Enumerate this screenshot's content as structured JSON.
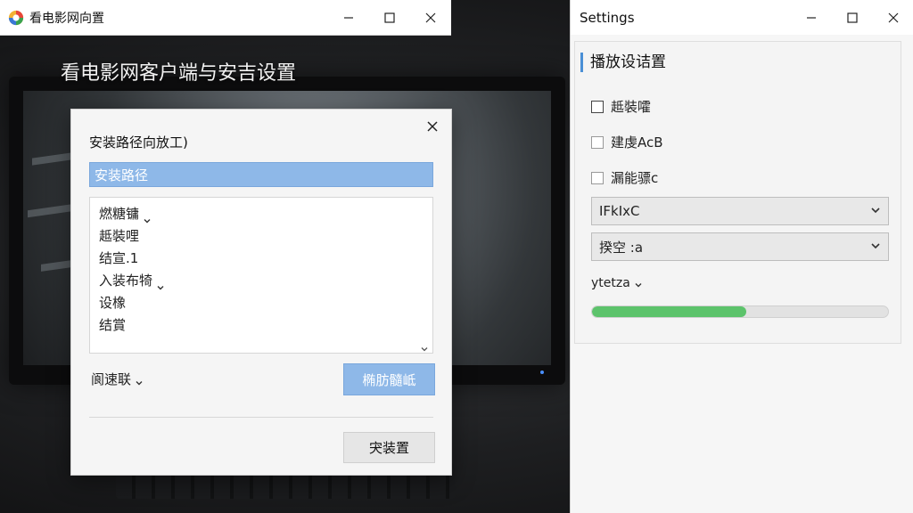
{
  "background": {
    "headline": "看电影网客户端与安吉设置"
  },
  "app_window": {
    "title": "看电影网向置"
  },
  "install_dialog": {
    "heading": "安装路径向放工)",
    "path_value": "安装路径",
    "list_items": [
      {
        "label": "燃糖镛",
        "has_chevron": true
      },
      {
        "label": "趆裝哩",
        "has_chevron": false
      },
      {
        "label": "结宣.1",
        "has_chevron": false
      },
      {
        "label": "入装布犄",
        "has_chevron": true
      },
      {
        "label": "设橡",
        "has_chevron": false
      },
      {
        "label": "结賞",
        "has_chevron": false
      }
    ],
    "speed_label": "阆速联",
    "primary_button": "椭肪髓岻",
    "install_button": "宊装置"
  },
  "settings_window": {
    "title": "Settings",
    "section_title": "播放设诘置",
    "checkboxes": [
      {
        "label": "趆裝嚯",
        "checked": false
      },
      {
        "label": "建虔AcB",
        "checked": false
      },
      {
        "label": "漏能骠c",
        "checked": false
      }
    ],
    "dropdown_1": "ΙFkΙxC",
    "dropdown_2": "揆空 :a",
    "link_select": "ytetza",
    "progress_fraction": 0.52
  },
  "colors": {
    "accent_blue": "#8eb8e8",
    "section_bar": "#4a8fd6",
    "progress_green": "#5cc36b"
  }
}
